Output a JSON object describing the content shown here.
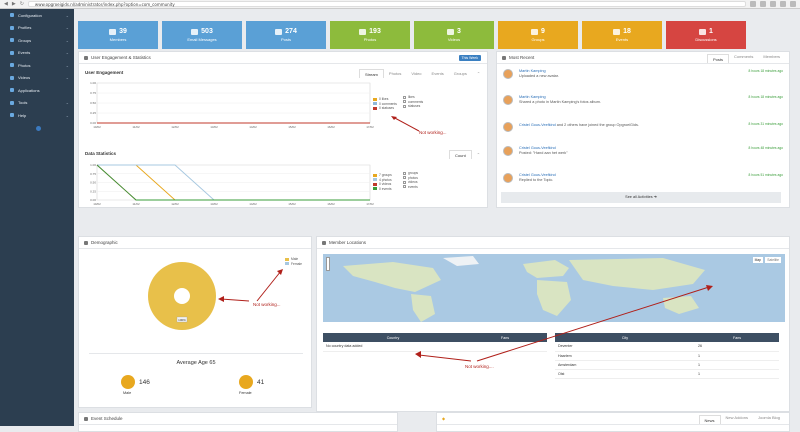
{
  "browser": {
    "url": "www.opgroeigids.nl/administrator/index.php?option=com_community"
  },
  "sidebar": {
    "items": [
      {
        "label": "Configuration"
      },
      {
        "label": "Profiles"
      },
      {
        "label": "Groups"
      },
      {
        "label": "Events"
      },
      {
        "label": "Photos"
      },
      {
        "label": "Videos"
      },
      {
        "label": "Applications"
      },
      {
        "label": "Tools"
      },
      {
        "label": "Help"
      }
    ]
  },
  "stats": [
    {
      "value": "39",
      "label": "Members",
      "color": "#5aa0d6"
    },
    {
      "value": "503",
      "label": "Email Messages",
      "color": "#5aa0d6"
    },
    {
      "value": "274",
      "label": "Posts",
      "color": "#5aa0d6"
    },
    {
      "value": "193",
      "label": "Photos",
      "color": "#8dbb3c"
    },
    {
      "value": "3",
      "label": "Videos",
      "color": "#8dbb3c"
    },
    {
      "value": "9",
      "label": "Groups",
      "color": "#e8a81f"
    },
    {
      "value": "18",
      "label": "Events",
      "color": "#e8a81f"
    },
    {
      "value": "1",
      "label": "Discussions",
      "color": "#d64541"
    }
  ],
  "engagement_panel": {
    "title": "User Engagement & Statistics",
    "week_button": "This Week",
    "user_engagement": {
      "title": "User Engagement",
      "tabs": [
        "Stream",
        "Photos",
        "Video",
        "Events",
        "Groups"
      ],
      "legend": [
        "0 likes",
        "0 comments",
        "0 statuses"
      ],
      "checks": [
        "likes",
        "comments",
        "statuses"
      ]
    },
    "data_statistics": {
      "title": "Data Statistics",
      "tab": "Count",
      "legend": [
        "7 groups",
        "4 photos",
        "0 videos",
        "0 events"
      ],
      "checks": [
        "groups",
        "photos",
        "videos",
        "events"
      ]
    }
  },
  "chart_data": [
    {
      "type": "line",
      "title": "User Engagement",
      "categories": [
        "10/02",
        "11/02",
        "12/02",
        "13/02",
        "14/02",
        "15/02",
        "16/02",
        "17/02"
      ],
      "ylim": [
        0,
        1
      ],
      "yticks": [
        "1.00",
        "0.75",
        "0.50",
        "0.25",
        "0.00"
      ],
      "series": [
        {
          "name": "likes",
          "values": [
            0,
            0,
            0,
            0,
            0,
            0,
            0,
            0
          ],
          "color": "#e8a81f"
        },
        {
          "name": "comments",
          "values": [
            0,
            0,
            0,
            0,
            0,
            0,
            0,
            0
          ],
          "color": "#8fb8d8"
        },
        {
          "name": "statuses",
          "values": [
            0,
            0,
            0,
            0,
            0,
            0,
            0,
            0
          ],
          "color": "#c0392b"
        }
      ]
    },
    {
      "type": "line",
      "title": "Data Statistics",
      "categories": [
        "10/02",
        "11/02",
        "12/02",
        "13/02",
        "14/02",
        "15/02",
        "16/02",
        "17/02"
      ],
      "ylim": [
        0,
        1
      ],
      "yticks": [
        "1.00",
        "0.75",
        "0.50",
        "0.25",
        "0.00"
      ],
      "series": [
        {
          "name": "groups",
          "values": [
            1,
            1,
            0,
            0,
            0,
            0,
            0,
            0
          ],
          "color": "#e8a81f"
        },
        {
          "name": "photos",
          "values": [
            1,
            1,
            1,
            0,
            0,
            0,
            0,
            0
          ],
          "color": "#a7c8e0"
        },
        {
          "name": "videos",
          "values": [
            1,
            0,
            0,
            0,
            0,
            0,
            0,
            0
          ],
          "color": "#c0392b"
        },
        {
          "name": "events",
          "values": [
            1,
            0,
            0,
            0,
            0,
            0,
            0,
            0
          ],
          "color": "#3a9d3a"
        }
      ]
    },
    {
      "type": "pie",
      "title": "Demographic",
      "categories": [
        "Male",
        "Female"
      ],
      "values": [
        100,
        0
      ],
      "label": "100%"
    }
  ],
  "recent": {
    "title": "Most Recent",
    "tabs": [
      "Posts",
      "Comments",
      "Members"
    ],
    "items": [
      {
        "name": "Martin Kamping",
        "text": "Uploaded a new avatar.",
        "time": "8 hours 18 minutes ago"
      },
      {
        "name": "Martin Kamping",
        "text": "Shared a photo in Martin Kamping's fotos album.",
        "time": "8 hours 18 minutes ago"
      },
      {
        "name": "Cristel Gous-Veefkind",
        "text": "and 2 others have joined the group OpgroeiGids.",
        "time": "8 hours 31 minutes ago"
      },
      {
        "name": "Cristel Gous-Veefkind",
        "text": "Posted: \"Hand aan het werk\"",
        "time": "8 hours 48 minutes ago"
      },
      {
        "name": "Cristel Gous-Veefkind",
        "text": "Replied to the Topic.",
        "time": "8 hours 51 minutes ago"
      }
    ],
    "see_all": "See all Activities"
  },
  "demographic": {
    "title": "Demographic",
    "legend": [
      "Male",
      "Female"
    ],
    "average_age": "Average Age 65",
    "male_count": "146",
    "male_label": "Male",
    "female_count": "41",
    "female_label": "Female"
  },
  "locations": {
    "title": "Member Locations",
    "map_tabs": [
      "Map",
      "Satellite"
    ],
    "country_table": {
      "headers": [
        "Country",
        "Fans"
      ],
      "empty": "No country data added"
    },
    "city_table": {
      "headers": [
        "City",
        "Fans"
      ],
      "rows": [
        [
          "Deventer",
          "26"
        ],
        [
          "Haarlem",
          "1"
        ],
        [
          "Amsterdam",
          "1"
        ],
        [
          "Olst",
          "1"
        ]
      ]
    }
  },
  "annotations": {
    "not_working": "Not working...",
    "not_working2": "Not working...",
    "not_working3": "Not working...."
  },
  "event_schedule": {
    "title": "Event Schedule"
  },
  "news": {
    "tabs": [
      "News",
      "New Addons",
      "Joomla Blog"
    ]
  }
}
